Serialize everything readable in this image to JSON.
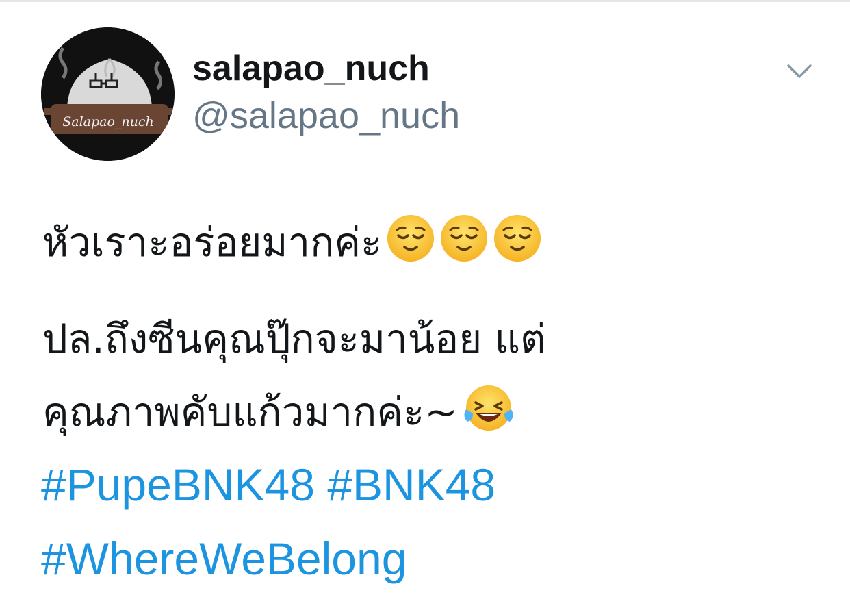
{
  "tweet": {
    "display_name": "salapao_nuch",
    "handle": "@salapao_nuch",
    "avatar_label": "Salapao_nuch",
    "text_line1": "หัวเราะอร่อยมากค่ะ",
    "text_line2": "ปล.ถึงซีนคุณปุ๊กจะมาน้อย แต่",
    "text_line3": "คุณภาพคับแก้วมากค่ะ~",
    "hashtags": [
      "#PupeBNK48",
      "#BNK48",
      "#WhereWeBelong"
    ],
    "line1_emojis": [
      "relieved-face-emoji",
      "relieved-face-emoji",
      "relieved-face-emoji"
    ],
    "line3_emojis": [
      "face-with-tears-of-joy-emoji"
    ]
  },
  "colors": {
    "name": "#14171a",
    "handle": "#657786",
    "hashtag": "#1c94e0",
    "divider": "#e3e6e8"
  }
}
